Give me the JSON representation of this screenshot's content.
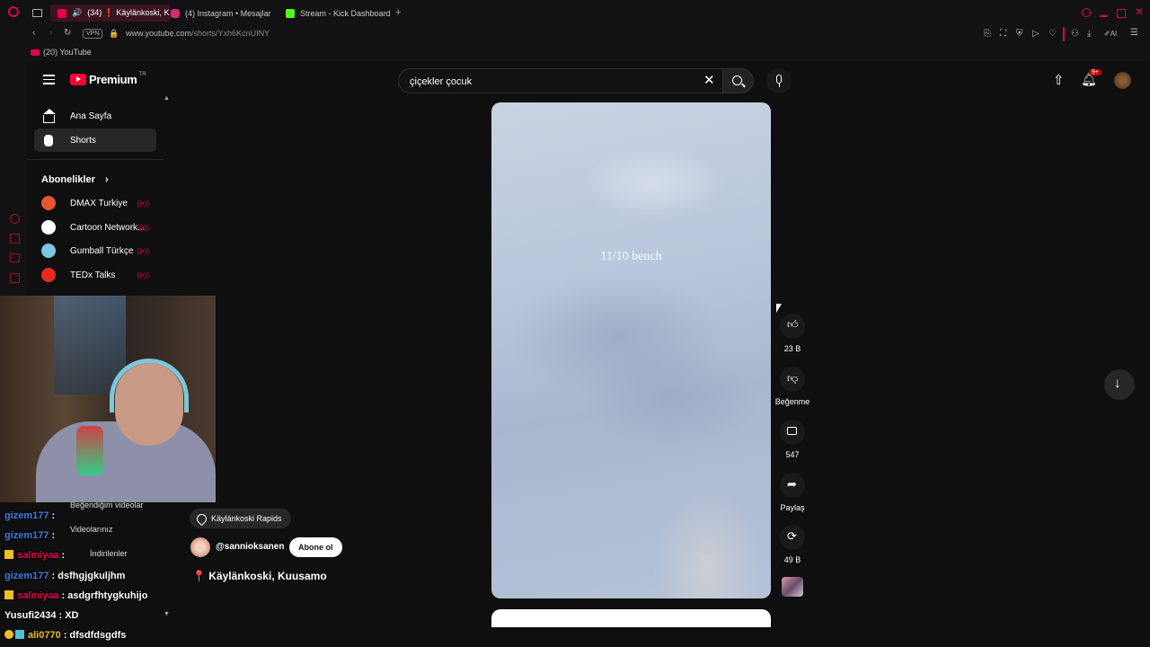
{
  "browser": {
    "tabs": [
      {
        "label": "(34) ❗ Käylänkoski, K",
        "active": true,
        "color": "#e4004b"
      },
      {
        "label": "(4) Instagram • Mesajlar",
        "active": false,
        "color": "#d62976"
      },
      {
        "label": "Stream - Kick Dashboard",
        "active": false,
        "color": "#53fc18"
      }
    ],
    "vpn_label": "VPN",
    "url_host": "www.youtube.com",
    "url_path": "/shorts/Yxh6KcnUINY",
    "bookmark": "(20) YouTube",
    "ai_label": "AI"
  },
  "youtube": {
    "logo_text": "Premium",
    "logo_region": "TR",
    "search_value": "çiçekler çocuk",
    "notif_badge": "9+",
    "sidebar": {
      "home": "Ana Sayfa",
      "shorts": "Shorts",
      "subs_title": "Abonelikler",
      "channels": [
        {
          "name": "DMAX Turkiye",
          "color": "#e4572e"
        },
        {
          "name": "Cartoon Network...",
          "color": "#ffffff"
        },
        {
          "name": "Gumball Türkçe",
          "color": "#7fc6e4"
        },
        {
          "name": "TEDx Talks",
          "color": "#e62b1e"
        }
      ],
      "lower_items": [
        "Beğendiğim videolar",
        "Videolarınız",
        "İndirilenler"
      ]
    },
    "short": {
      "overlay_text": "11/10 bench",
      "location": "Käylänkoski Rapids",
      "channel": "@sannioksanen",
      "subscribe": "Abone ol",
      "title": "📍 Käylänkoski, Kuusamo",
      "likes": "23 B",
      "dislike": "Beğenme",
      "comments": "547",
      "share": "Paylaş",
      "remix": "49 B"
    }
  },
  "chat": [
    {
      "user": "gizem177",
      "msg": ":",
      "color": "#3f7fe0",
      "badge": false
    },
    {
      "user": "gizem177",
      "msg": ":",
      "color": "#3f7fe0",
      "badge": false
    },
    {
      "user": "salmiyaa",
      "msg": ":",
      "color": "#e4004b",
      "badge": true
    },
    {
      "user": "gizem177",
      "msg": ": dsfhgjgkuljhm",
      "color": "#3f7fe0",
      "badge": false
    },
    {
      "user": "salmiyaa",
      "msg": ": asdgrfhtygkuhijo",
      "color": "#e4004b",
      "badge": true
    },
    {
      "user": "Yusufi2434",
      "msg": ": XD",
      "color": "#ffffff",
      "badge": false
    },
    {
      "user": "ali0770",
      "msg": ": dfsdfdsgdfs",
      "color": "#f0c020",
      "badge": true
    }
  ]
}
